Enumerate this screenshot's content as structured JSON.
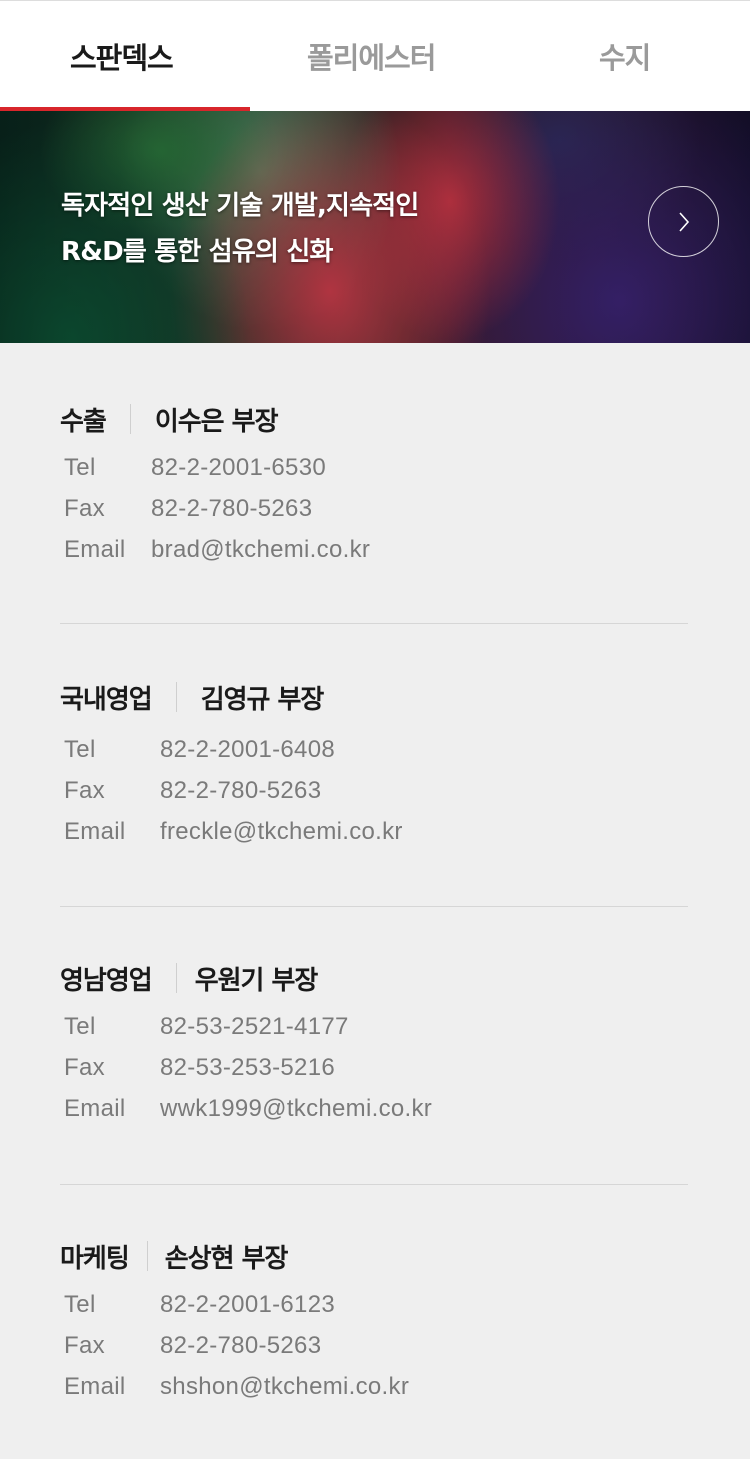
{
  "tabs": [
    {
      "label": "스판덱스",
      "active": true
    },
    {
      "label": "폴리에스터",
      "active": false
    },
    {
      "label": "수지",
      "active": false
    }
  ],
  "accent_color": "#d8262b",
  "banner": {
    "line1": "독자적인 생산 기술 개발,지속적인",
    "line2": "R&D를 통한 섬유의 신화",
    "next_icon": "chevron-right-icon"
  },
  "field_labels": {
    "tel": "Tel",
    "fax": "Fax",
    "email": "Email"
  },
  "contacts": [
    {
      "dept": "수출",
      "person": "이수은 부장",
      "tel": "82-2-2001-6530",
      "fax": "82-2-780-5263",
      "email": "brad@tkchemi.co.kr"
    },
    {
      "dept": "국내영업",
      "person": "김영규 부장",
      "tel": "82-2-2001-6408",
      "fax": "82-2-780-5263",
      "email": "freckle@tkchemi.co.kr"
    },
    {
      "dept": "영남영업",
      "person": "우원기 부장",
      "tel": "82-53-2521-4177",
      "fax": "82-53-253-5216",
      "email": "wwk1999@tkchemi.co.kr"
    },
    {
      "dept": "마케팅",
      "person": "손상현 부장",
      "tel": "82-2-2001-6123",
      "fax": "82-2-780-5263",
      "email": "shshon@tkchemi.co.kr"
    }
  ]
}
